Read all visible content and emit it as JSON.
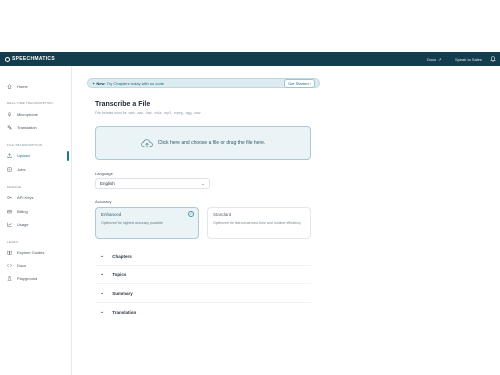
{
  "brand": {
    "name": "SPEECHMATICS"
  },
  "topnav": {
    "docs": "Docs",
    "docs_ext": "↗",
    "sales": "Speak to Sales",
    "bell": "🔔"
  },
  "sidebar": {
    "home": "Home",
    "sections": {
      "realtime": "Real-time transcription",
      "file": "File transcription",
      "manage": "Manage",
      "learn": "Learn"
    },
    "items": {
      "microphone": "Microphone",
      "translation": "Translation",
      "upload": "Upload",
      "jobs": "Jobs",
      "api_keys": "API Keys",
      "billing": "Billing",
      "usage": "Usage",
      "explore_guides": "Explore Guides",
      "docs": "Docs",
      "playground": "Playground"
    }
  },
  "banner": {
    "badge": "New",
    "text": "Try Chapters today with no code",
    "button": "Get Started ›"
  },
  "main": {
    "title": "Transcribe a File",
    "subtitle": "File formats must be .wav, .aac, .flac, .m4a, .mp3, .mpeg, .ogg, .wav",
    "dropzone": "Click here and choose a file or drag the file here.",
    "language_label": "Language",
    "language_value": "English",
    "accuracy_label": "Accuracy",
    "accuracy": {
      "enhanced_title": "Enhanced",
      "enhanced_desc": "Optimized for highest accuracy possible",
      "standard_title": "Standard",
      "standard_desc": "Optimized for fast turnaround time and runtime efficiency",
      "selected": "Enhanced"
    },
    "accordions": [
      "Chapters",
      "Topics",
      "Summary",
      "Translation"
    ]
  }
}
